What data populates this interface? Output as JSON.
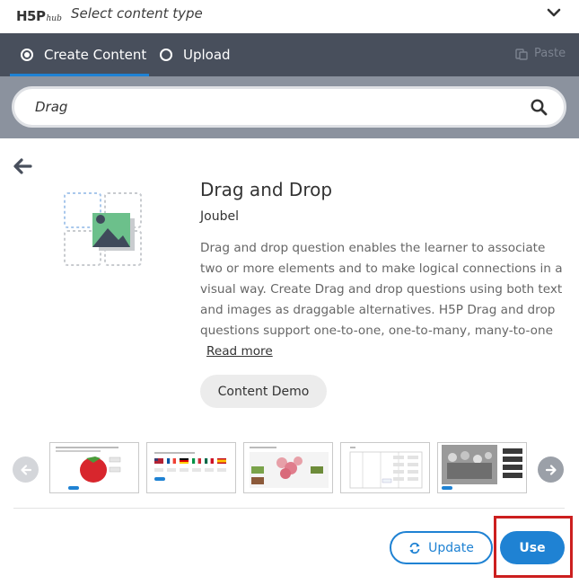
{
  "header": {
    "logo_h5p": "H5P",
    "logo_hub": "hub",
    "title": "Select content type",
    "chevron_icon": "chevron-down-icon"
  },
  "tabs": [
    {
      "label": "Create Content",
      "selected": true
    },
    {
      "label": "Upload",
      "selected": false
    }
  ],
  "paste": {
    "label": "Paste",
    "icon": "paste-icon"
  },
  "search": {
    "value": "Drag",
    "icon": "search-icon"
  },
  "content": {
    "title": "Drag and Drop",
    "owner": "Joubel",
    "description": "Drag and drop question enables the learner to associate two or more elements and to make logical connections in a visual way. Create Drag and drop questions using both text and images as draggable alternatives. H5P Drag and drop questions support one-to-one, one-to-many, many-to-one a...",
    "read_more": "Read more",
    "demo_button": "Content Demo"
  },
  "carousel": {
    "screenshots": [
      {
        "name": "strawberry-screenshot"
      },
      {
        "name": "flags-screenshot"
      },
      {
        "name": "fruits-screenshot"
      },
      {
        "name": "table-screenshot"
      },
      {
        "name": "photo-screenshot"
      }
    ]
  },
  "footer": {
    "update_label": "Update",
    "use_label": "Use"
  },
  "colors": {
    "accent": "#1f82d3",
    "tabbar": "#484f5c",
    "searchbar": "#8b929e",
    "highlight": "#cc1f1f"
  }
}
